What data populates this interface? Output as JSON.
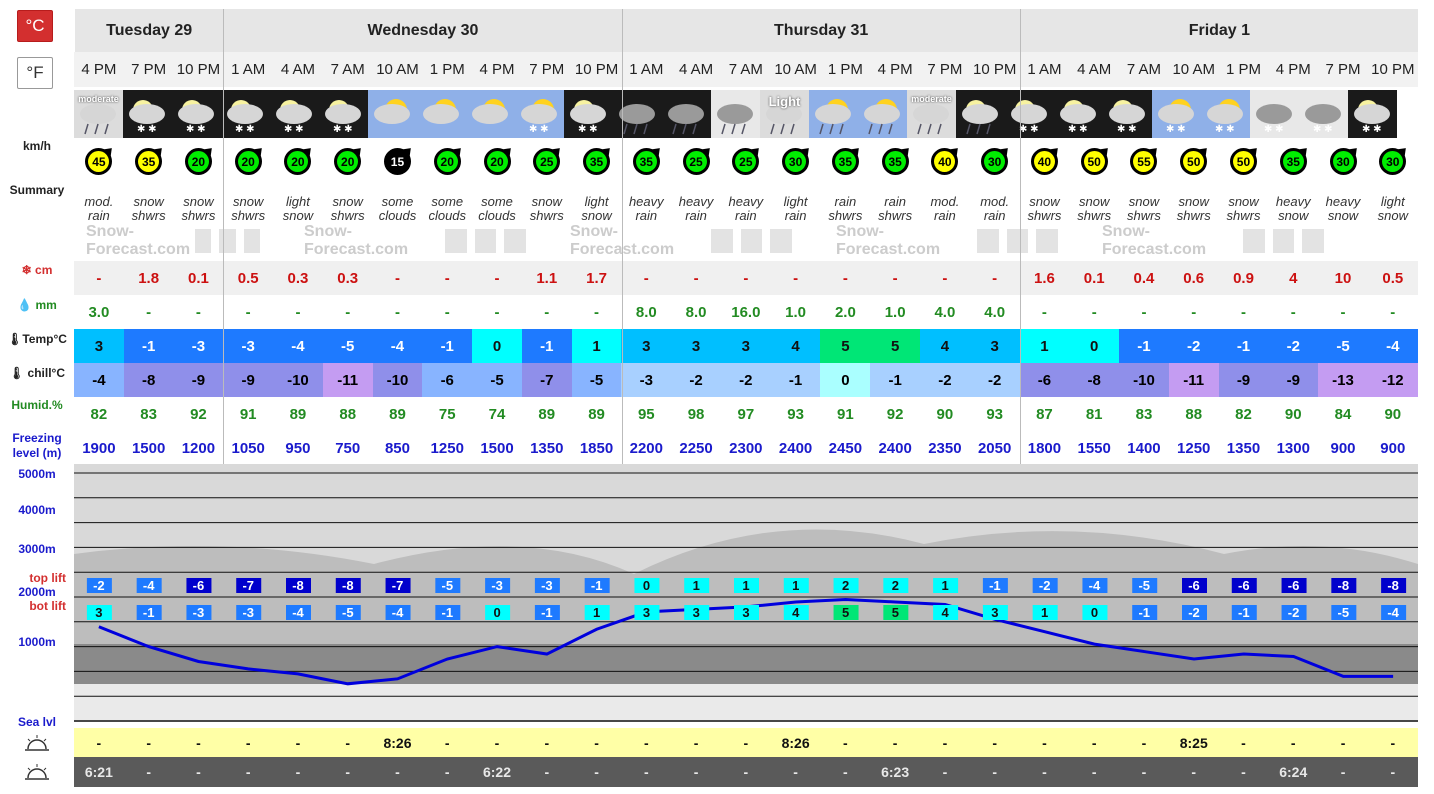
{
  "units": {
    "celsius_label": "°C",
    "fahrenheit_label": "°F",
    "wind_unit": "km/h"
  },
  "labels": {
    "summary": "Summary",
    "snow": "cm",
    "rain": "mm",
    "temp": "Temp°C",
    "chill": "chill°C",
    "humid": "Humid.%",
    "freezing": "Freezing level (m)",
    "alt_5000": "5000m",
    "alt_4000": "4000m",
    "alt_3000": "3000m",
    "alt_2000": "2000m",
    "alt_1000": "1000m",
    "sea_level": "Sea lvl",
    "top_lift": "top lift",
    "bot_lift": "bot lift"
  },
  "watermark": "Snow-Forecast.com",
  "days": [
    {
      "name": "Tuesday 29",
      "count": 3
    },
    {
      "name": "Wednesday 30",
      "count": 8
    },
    {
      "name": "Thursday 31",
      "count": 8
    },
    {
      "name": "Friday 1",
      "count": 8
    }
  ],
  "times": [
    "4 PM",
    "7 PM",
    "10 PM",
    "1 AM",
    "4 AM",
    "7 AM",
    "10 AM",
    "1 PM",
    "4 PM",
    "7 PM",
    "10 PM",
    "1 AM",
    "4 AM",
    "7 AM",
    "10 AM",
    "1 PM",
    "4 PM",
    "7 PM",
    "10 PM",
    "1 AM",
    "4 AM",
    "7 AM",
    "10 AM",
    "1 PM",
    "4 PM",
    "7 PM",
    "10 PM"
  ],
  "icons": [
    "moderate",
    "snow-night",
    "snow-night",
    "snow-night",
    "snow-night",
    "snow-night",
    "cloud-sun",
    "cloud-sun",
    "cloud-sun",
    "snow-sun",
    "snow-night",
    "heavy-rain-night",
    "heavy-rain-night",
    "heavy-rain",
    "light",
    "rain-sun",
    "rain-sun",
    "moderate",
    "rain-night",
    "snow-night",
    "snow-night",
    "snow-night",
    "snow-sun",
    "snow-sun",
    "heavy-snow",
    "heavy-snow",
    "snow-night"
  ],
  "icon_labels": {
    "0": "moderate",
    "14": "Light",
    "17": "moderate"
  },
  "wind": [
    45,
    35,
    20,
    20,
    20,
    20,
    15,
    20,
    20,
    25,
    35,
    35,
    25,
    25,
    30,
    35,
    35,
    40,
    30,
    40,
    50,
    55,
    50,
    50,
    35,
    30,
    30
  ],
  "wind_colors": [
    "#ffff00",
    "#ffff00",
    "#00ee00",
    "#00ee00",
    "#00ee00",
    "#00ee00",
    "#000000",
    "#00ee00",
    "#00ee00",
    "#00ee00",
    "#00ee00",
    "#00ee00",
    "#00ee00",
    "#00ee00",
    "#00ee00",
    "#00ee00",
    "#00ee00",
    "#ffff00",
    "#00ee00",
    "#ffff00",
    "#ffff00",
    "#ffff00",
    "#ffff00",
    "#ffff00",
    "#00ee00",
    "#00ee00",
    "#00ee00"
  ],
  "summary": [
    "mod. rain",
    "snow shwrs",
    "snow shwrs",
    "snow shwrs",
    "light snow",
    "snow shwrs",
    "some clouds",
    "some clouds",
    "some clouds",
    "snow shwrs",
    "light snow",
    "heavy rain",
    "heavy rain",
    "heavy rain",
    "light rain",
    "rain shwrs",
    "rain shwrs",
    "mod. rain",
    "mod. rain",
    "snow shwrs",
    "snow shwrs",
    "snow shwrs",
    "snow shwrs",
    "snow shwrs",
    "heavy snow",
    "heavy snow",
    "light snow"
  ],
  "snow": [
    "-",
    "1.8",
    "0.1",
    "0.5",
    "0.3",
    "0.3",
    "-",
    "-",
    "-",
    "1.1",
    "1.7",
    "-",
    "-",
    "-",
    "-",
    "-",
    "-",
    "-",
    "-",
    "1.6",
    "0.1",
    "0.4",
    "0.6",
    "0.9",
    "4",
    "10",
    "0.5"
  ],
  "rain": [
    "3.0",
    "-",
    "-",
    "-",
    "-",
    "-",
    "-",
    "-",
    "-",
    "-",
    "-",
    "8.0",
    "8.0",
    "16.0",
    "1.0",
    "2.0",
    "1.0",
    "4.0",
    "4.0",
    "-",
    "-",
    "-",
    "-",
    "-",
    "-",
    "-",
    "-"
  ],
  "temp": [
    "3",
    "-1",
    "-3",
    "-3",
    "-4",
    "-5",
    "-4",
    "-1",
    "0",
    "-1",
    "1",
    "3",
    "3",
    "3",
    "4",
    "5",
    "5",
    "4",
    "3",
    "1",
    "0",
    "-1",
    "-2",
    "-1",
    "-2",
    "-5",
    "-4"
  ],
  "temp_colors": [
    "#00bfff",
    "#1e7aff",
    "#1e7aff",
    "#1e7aff",
    "#1e7aff",
    "#1e7aff",
    "#1e7aff",
    "#1e7aff",
    "#00ffff",
    "#1e7aff",
    "#00ffff",
    "#00bfff",
    "#00bfff",
    "#00bfff",
    "#00bfff",
    "#00e676",
    "#00e676",
    "#00bfff",
    "#00bfff",
    "#00ffff",
    "#00ffff",
    "#1e7aff",
    "#1e7aff",
    "#1e7aff",
    "#1e7aff",
    "#1e7aff",
    "#1e7aff"
  ],
  "chill": [
    "-4",
    "-8",
    "-9",
    "-9",
    "-10",
    "-11",
    "-10",
    "-6",
    "-5",
    "-7",
    "-5",
    "-3",
    "-2",
    "-2",
    "-1",
    "0",
    "-1",
    "-2",
    "-2",
    "-6",
    "-8",
    "-10",
    "-11",
    "-9",
    "-9",
    "-13",
    "-12"
  ],
  "chill_colors": [
    "#88b4ff",
    "#8f8fea",
    "#8f8fea",
    "#8f8fea",
    "#8f8fea",
    "#c49cf2",
    "#8f8fea",
    "#88b4ff",
    "#88b4ff",
    "#8f8fea",
    "#88b4ff",
    "#a8d0ff",
    "#a8d0ff",
    "#a8d0ff",
    "#a8d0ff",
    "#aaffff",
    "#a8d0ff",
    "#a8d0ff",
    "#a8d0ff",
    "#8f8fea",
    "#8f8fea",
    "#8f8fea",
    "#c49cf2",
    "#8f8fea",
    "#8f8fea",
    "#c49cf2",
    "#c49cf2"
  ],
  "humidity": [
    "82",
    "83",
    "92",
    "91",
    "89",
    "88",
    "89",
    "75",
    "74",
    "89",
    "89",
    "95",
    "98",
    "97",
    "93",
    "91",
    "92",
    "90",
    "93",
    "87",
    "81",
    "83",
    "88",
    "82",
    "90",
    "84",
    "90"
  ],
  "freezing": [
    "1900",
    "1500",
    "1200",
    "1050",
    "950",
    "750",
    "850",
    "1250",
    "1500",
    "1350",
    "1850",
    "2200",
    "2250",
    "2300",
    "2400",
    "2450",
    "2400",
    "2350",
    "2050",
    "1800",
    "1550",
    "1400",
    "1250",
    "1350",
    "1300",
    "900",
    "900"
  ],
  "top_lift": [
    "-2",
    "-4",
    "-6",
    "-7",
    "-8",
    "-8",
    "-7",
    "-5",
    "-3",
    "-3",
    "-1",
    "0",
    "1",
    "1",
    "1",
    "2",
    "2",
    "1",
    "-1",
    "-2",
    "-4",
    "-5",
    "-6",
    "-6",
    "-6",
    "-8",
    "-8"
  ],
  "top_lift_colors": [
    "#1e7aff",
    "#1e7aff",
    "#0000cc",
    "#0000cc",
    "#0000cc",
    "#0000cc",
    "#0000cc",
    "#1e7aff",
    "#1e7aff",
    "#1e7aff",
    "#1e7aff",
    "#00ffff",
    "#00ffff",
    "#00ffff",
    "#00ffff",
    "#00ffff",
    "#00ffff",
    "#00ffff",
    "#1e7aff",
    "#1e7aff",
    "#1e7aff",
    "#1e7aff",
    "#0000cc",
    "#0000cc",
    "#0000cc",
    "#0000cc",
    "#0000cc"
  ],
  "bot_lift": [
    "3",
    "-1",
    "-3",
    "-3",
    "-4",
    "-5",
    "-4",
    "-1",
    "0",
    "-1",
    "1",
    "3",
    "3",
    "3",
    "4",
    "5",
    "5",
    "4",
    "3",
    "1",
    "0",
    "-1",
    "-2",
    "-1",
    "-2",
    "-5",
    "-4"
  ],
  "bot_lift_colors": [
    "#00ffff",
    "#1e7aff",
    "#1e7aff",
    "#1e7aff",
    "#1e7aff",
    "#1e7aff",
    "#1e7aff",
    "#1e7aff",
    "#00ffff",
    "#1e7aff",
    "#00ffff",
    "#00ffff",
    "#00ffff",
    "#00ffff",
    "#00ffff",
    "#00e676",
    "#00e676",
    "#00ffff",
    "#00ffff",
    "#00ffff",
    "#00ffff",
    "#1e7aff",
    "#1e7aff",
    "#1e7aff",
    "#1e7aff",
    "#1e7aff",
    "#1e7aff"
  ],
  "sunrise": [
    "-",
    "-",
    "-",
    "-",
    "-",
    "-",
    "8:26",
    "-",
    "-",
    "-",
    "-",
    "-",
    "-",
    "-",
    "8:26",
    "-",
    "-",
    "-",
    "-",
    "-",
    "-",
    "-",
    "8:25",
    "-",
    "-",
    "-",
    "-"
  ],
  "sunset": [
    "6:21",
    "-",
    "-",
    "-",
    "-",
    "-",
    "-",
    "-",
    "6:22",
    "-",
    "-",
    "-",
    "-",
    "-",
    "-",
    "-",
    "6:23",
    "-",
    "-",
    "-",
    "-",
    "-",
    "-",
    "-",
    "6:24",
    "-",
    "-"
  ]
}
